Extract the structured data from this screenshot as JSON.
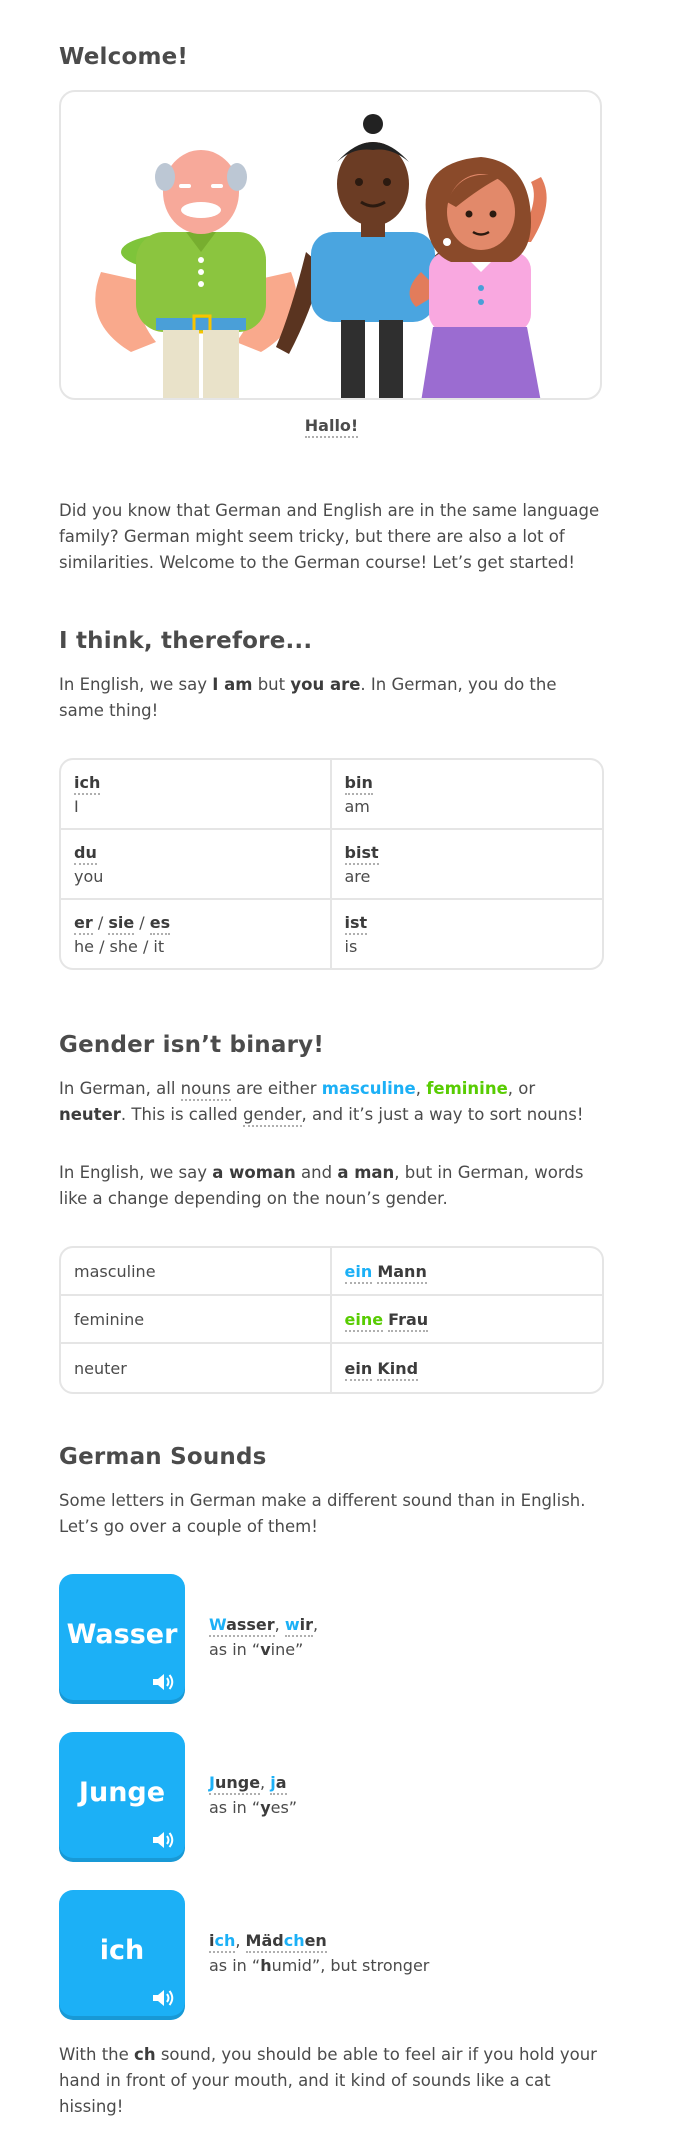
{
  "welcome": {
    "title": "Welcome!",
    "hallo": "Hallo!",
    "intro": "Did you know that German and English are in the same language family? German might seem tricky, but there are also a lot of similarities. Welcome to the German course! Let’s get started!"
  },
  "think": {
    "title": "I think, therefore...",
    "p1_a": "In English, we say ",
    "p1_b": "I am",
    "p1_c": " but ",
    "p1_d": "you are",
    "p1_e": ". In German, you do the same thing!",
    "rows": [
      {
        "de1": "ich",
        "en1": "I",
        "de2": "bin",
        "en2": "am"
      },
      {
        "de1": "du",
        "en1": "you",
        "de2": "bist",
        "en2": "are"
      },
      {
        "de1a": "er",
        "de1b": "sie",
        "de1c": "es",
        "sep": " / ",
        "en1": "he / she / it",
        "de2": "ist",
        "en2": "is"
      }
    ]
  },
  "gender": {
    "title": "Gender isn’t binary!",
    "p1_a": "In German, all ",
    "p1_nouns": "nouns",
    "p1_b": " are either ",
    "p1_masc": "masculine",
    "p1_comma1": ", ",
    "p1_fem": "feminine",
    "p1_c": ", or ",
    "p1_neut": "neuter",
    "p1_d": ". This is called ",
    "p1_gender": "gender",
    "p1_e": ", and it’s just a way to sort nouns!",
    "p2_a": "In English, we say ",
    "p2_b": "a woman",
    "p2_c": " and ",
    "p2_d": "a man",
    "p2_e": ", but in German, words like a change depending on the noun’s gender.",
    "rows": [
      {
        "label": "masculine",
        "article": "ein",
        "noun": "Mann"
      },
      {
        "label": "feminine",
        "article": "eine",
        "noun": "Frau"
      },
      {
        "label": "neuter",
        "article": "ein",
        "noun": "Kind"
      }
    ]
  },
  "sounds": {
    "title": "German Sounds",
    "intro": "Some letters in German make a different sound than in English. Let’s go over a couple of them!",
    "items": [
      {
        "tile": "Wasser",
        "w1_hl": "W",
        "w1_rest": "asser",
        "comma": ", ",
        "w2_hl": "w",
        "w2_rest": "ir",
        "end": ",",
        "as_a": "as in “",
        "as_hl": "v",
        "as_b": "ine”"
      },
      {
        "tile": "Junge",
        "w1_hl": "J",
        "w1_rest": "unge",
        "comma": ", ",
        "w2_hl": "j",
        "w2_rest": "a",
        "as_a": "as in “",
        "as_hl": "y",
        "as_b": "es”"
      },
      {
        "tile": "ich",
        "w1_pre": "i",
        "w1_hl": "ch",
        "comma": ", ",
        "w2_pre": "Mäd",
        "w2_hl": "ch",
        "w2_rest": "en",
        "as_a": "as in “",
        "as_hl": "h",
        "as_b": "umid”, but stronger"
      }
    ],
    "outro_a": "With the ",
    "outro_b": "ch",
    "outro_c": " sound, you should be able to feel air if you hold your hand in front of your mouth, and it kind of sounds like a cat hissing!"
  },
  "colors": {
    "blue": "#1cb0f6",
    "green": "#58cc02",
    "border": "#e5e5e5",
    "text": "#4b4b4b"
  }
}
